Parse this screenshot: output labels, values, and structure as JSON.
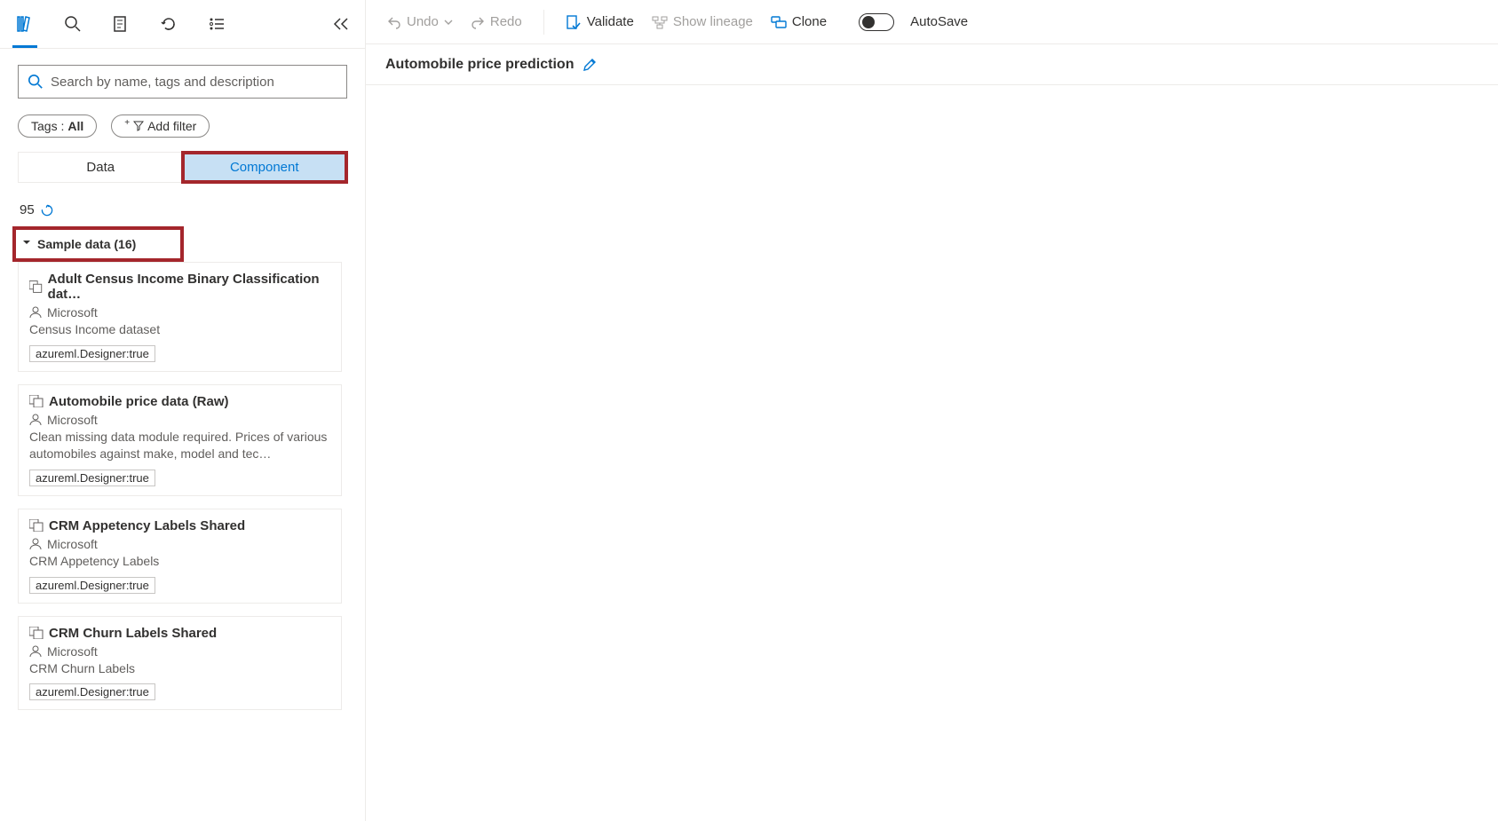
{
  "left_panel": {
    "search_placeholder": "Search by name, tags and description",
    "tags_label": "Tags : ",
    "tags_value": "All",
    "add_filter": "Add filter",
    "tab_data": "Data",
    "tab_component": "Component",
    "result_count": "95",
    "group_label": "Sample data (16)",
    "cards": [
      {
        "title": "Adult Census Income Binary Classification dat…",
        "author": "Microsoft",
        "desc": "Census Income dataset",
        "tag": "azureml.Designer:true"
      },
      {
        "title": "Automobile price data (Raw)",
        "author": "Microsoft",
        "desc": "Clean missing data module required. Prices of various automobiles against make, model and tec…",
        "tag": "azureml.Designer:true"
      },
      {
        "title": "CRM Appetency Labels Shared",
        "author": "Microsoft",
        "desc": "CRM Appetency Labels",
        "tag": "azureml.Designer:true"
      },
      {
        "title": "CRM Churn Labels Shared",
        "author": "Microsoft",
        "desc": "CRM Churn Labels",
        "tag": "azureml.Designer:true"
      }
    ]
  },
  "toolbar": {
    "undo": "Undo",
    "redo": "Redo",
    "validate": "Validate",
    "show_lineage": "Show lineage",
    "clone": "Clone",
    "autosave": "AutoSave"
  },
  "canvas": {
    "title": "Automobile price prediction"
  }
}
